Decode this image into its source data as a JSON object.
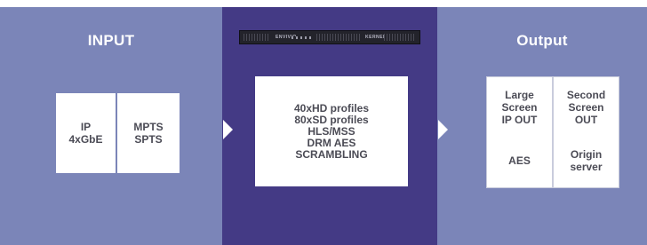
{
  "colors": {
    "side_panel": "#7b85b8",
    "center_panel": "#443a85",
    "box_fill": "#ffffff",
    "box_text": "#4b4b55"
  },
  "input": {
    "title": "INPUT",
    "boxes": [
      {
        "lines": [
          "IP",
          "4xGbE"
        ]
      },
      {
        "lines": [
          "MPTS",
          "SPTS"
        ]
      }
    ]
  },
  "center": {
    "device_labels": [
      "ENVIVIO",
      "KERNEL"
    ],
    "lines": [
      "40xHD profiles",
      "80xSD profiles",
      "HLS/MSS",
      "DRM AES",
      "SCRAMBLING"
    ]
  },
  "output": {
    "title": "Output",
    "boxes": [
      {
        "lines": [
          "Large",
          "Screen",
          "IP OUT"
        ]
      },
      {
        "lines": [
          "Second",
          "Screen",
          "OUT"
        ]
      },
      {
        "lines": [
          "AES"
        ]
      },
      {
        "lines": [
          "Origin",
          "server"
        ]
      }
    ]
  }
}
